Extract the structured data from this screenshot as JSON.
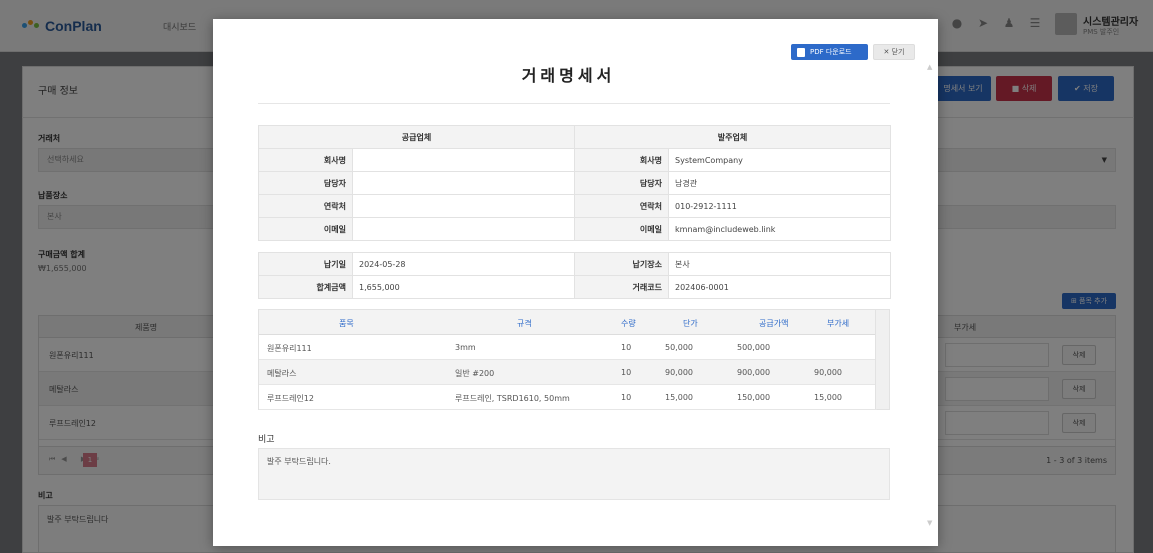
{
  "app": {
    "logo": "ConPlan",
    "nav": "대시보드",
    "user_name": "시스템관리자",
    "user_sub": "PMS 발주인"
  },
  "page": {
    "title": "구매 정보",
    "buttons": {
      "preview": "명세서 보기",
      "delete": "삭제",
      "save": "저장"
    },
    "vendor_label": "거래처",
    "vendor_placeholder": "선택하세요",
    "delivery_label": "납품장소",
    "delivery_value": "본사",
    "total_label": "구매금액 합계",
    "total_value": "₩1,655,000",
    "add_item": "품목 추가",
    "grid_headers": {
      "product": "제품명",
      "vat": "부가세"
    },
    "grid_rows": [
      "원폰유리111",
      "메탈라스",
      "루프드레인12"
    ],
    "delete_btn": "삭제",
    "pager_count": "1 - 3 of 3 items",
    "pager_page": "1",
    "memo_label": "비고",
    "memo_text": "발주 부탁드립니다"
  },
  "modal": {
    "pdf_button": "PDF 다운로드",
    "close_button": "닫기",
    "title": "거래명세서",
    "supplier_header": "공급업체",
    "buyer_header": "발주업체",
    "fields": {
      "company": "회사명",
      "manager": "담당자",
      "phone": "연락처",
      "email": "이메일"
    },
    "supplier": {
      "company": "",
      "manager": "",
      "phone": "",
      "email": ""
    },
    "buyer": {
      "company": "SystemCompany",
      "manager": "남경관",
      "phone": "010-2912-1111",
      "email": "kmnam@includeweb.link"
    },
    "delivery_date_label": "납기일",
    "delivery_date": "2024-05-28",
    "delivery_place_label": "납기장소",
    "delivery_place": "본사",
    "total_label": "합계금액",
    "total": "1,655,000",
    "trade_code_label": "거래코드",
    "trade_code": "202406-0001",
    "item_headers": {
      "item": "품목",
      "spec": "규격",
      "qty": "수량",
      "unit_price": "단가",
      "supply_price": "공급가액",
      "vat": "부가세"
    },
    "items": [
      {
        "item": "원폰유리111",
        "spec": "3mm",
        "qty": "10",
        "unit_price": "50,000",
        "supply_price": "500,000",
        "vat": ""
      },
      {
        "item": "메탈라스",
        "spec": "일반 #200",
        "qty": "10",
        "unit_price": "90,000",
        "supply_price": "900,000",
        "vat": "90,000"
      },
      {
        "item": "루프드레인12",
        "spec": "루프드레인, TSRD1610, 50mm",
        "qty": "10",
        "unit_price": "15,000",
        "supply_price": "150,000",
        "vat": "15,000"
      }
    ],
    "memo_label": "비고",
    "memo_text": "발주 부탁드립니다."
  },
  "colors": {
    "primary": "#2d6ac9",
    "danger": "#c9324a",
    "header_bg": "#f3f3f3"
  },
  "icons": [
    "logo-icon",
    "send-icon",
    "users-icon",
    "menu-icon",
    "avatar-icon",
    "pdf-icon",
    "close-icon",
    "trash-icon",
    "check-icon",
    "plus-icon",
    "caret-down-icon"
  ]
}
